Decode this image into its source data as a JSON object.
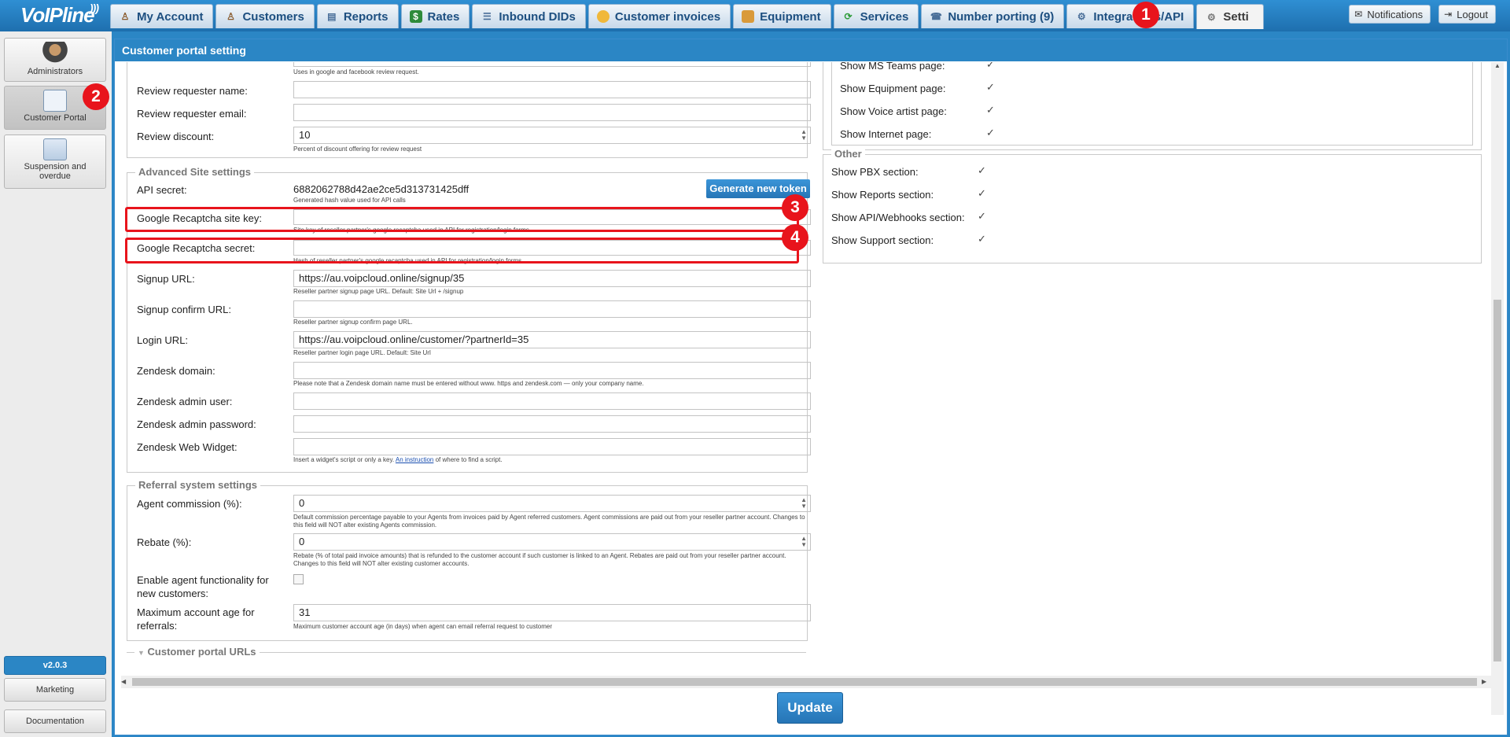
{
  "brand": {
    "logo": "VoIPline"
  },
  "tabs": [
    {
      "label": "My Account",
      "icon": "person-icon",
      "color": "#8a5a2b"
    },
    {
      "label": "Customers",
      "icon": "customers-icon",
      "color": "#8a5a2b"
    },
    {
      "label": "Reports",
      "icon": "reports-icon",
      "color": "#4a6f99"
    },
    {
      "label": "Rates",
      "icon": "rates-icon",
      "color": "#2e8b3a"
    },
    {
      "label": "Inbound DIDs",
      "icon": "list-icon",
      "color": "#4a6f99"
    },
    {
      "label": "Customer invoices",
      "icon": "coins-icon",
      "color": "#e0a21e"
    },
    {
      "label": "Equipment",
      "icon": "box-icon",
      "color": "#c98a2a"
    },
    {
      "label": "Services",
      "icon": "services-icon",
      "color": "#2e9c3a"
    },
    {
      "label": "Number porting (9)",
      "icon": "phone-icon",
      "color": "#4a6f99"
    },
    {
      "label": "Integrations/API",
      "icon": "gear-icon",
      "color": "#4a6f99"
    },
    {
      "label": "Setti",
      "icon": "settings-icon",
      "color": "#7a7a7a"
    }
  ],
  "top_right": {
    "notifications": "Notifications",
    "logout": "Logout"
  },
  "badges": {
    "b1": "1",
    "b2": "2",
    "b3": "3",
    "b4": "4"
  },
  "sidebar": {
    "items": [
      {
        "label": "Administrators"
      },
      {
        "label": "Customer Portal"
      },
      {
        "label": "Suspension and overdue"
      }
    ],
    "version": "v2.0.3",
    "marketing": "Marketing",
    "documentation": "Documentation"
  },
  "panel": {
    "title": "Customer portal setting"
  },
  "review": {
    "top_hint": "Uses in google and facebook review request.",
    "requester_name_label": "Review requester name:",
    "requester_email_label": "Review requester email:",
    "discount_label": "Review discount:",
    "discount_value": "10",
    "discount_hint": "Percent of discount offering for review request"
  },
  "advanced": {
    "legend": "Advanced Site settings",
    "api_secret_label": "API secret:",
    "api_secret_value": "6882062788d42ae2ce5d313731425dff",
    "api_secret_hint": "Generated hash value used for API calls",
    "generate_button": "Generate new token",
    "recaptcha_key_label": "Google Recaptcha site key:",
    "recaptcha_key_hint": "Site key of reseller partner's google recaptcha used in API for registration/login forms",
    "recaptcha_secret_label": "Google Recaptcha secret:",
    "recaptcha_secret_hint": "Hash of reseller partner's google recaptcha used in API for registration/login forms",
    "signup_url_label": "Signup URL:",
    "signup_url_value": "https://au.voipcloud.online/signup/35",
    "signup_url_hint": "Reseller partner signup page URL. Default: Site Url + /signup",
    "signup_confirm_label": "Signup confirm URL:",
    "signup_confirm_hint": "Reseller partner signup confirm page URL.",
    "login_url_label": "Login URL:",
    "login_url_value": "https://au.voipcloud.online/customer/?partnerId=35",
    "login_url_hint": "Reseller partner login page URL. Default: Site Url",
    "zendesk_domain_label": "Zendesk domain:",
    "zendesk_domain_hint": "Please note that a Zendesk domain name must be entered without www. https and zendesk.com — only your company name.",
    "zendesk_user_label": "Zendesk admin user:",
    "zendesk_password_label": "Zendesk admin password:",
    "zendesk_widget_label": "Zendesk Web Widget:",
    "zendesk_widget_hint_a": "Insert a widget's script or only a key.",
    "zendesk_widget_hint_link": "An instruction",
    "zendesk_widget_hint_b": "of where to find a script."
  },
  "referral": {
    "legend": "Referral system settings",
    "agent_commission_label": "Agent commission (%):",
    "agent_commission_value": "0",
    "agent_commission_hint": "Default commission percentage payable to your Agents from invoices paid by Agent referred customers. Agent commissions are paid out from your reseller partner account. Changes to this field will NOT alter existing Agents commission.",
    "rebate_label": "Rebate (%):",
    "rebate_value": "0",
    "rebate_hint": "Rebate (% of total paid invoice amounts) that is refunded to the customer account if such customer is linked to an Agent. Rebates are paid out from your reseller partner account. Changes to this field will NOT alter existing customer accounts.",
    "enable_agent_label": "Enable agent functionality for new customers:",
    "max_age_label": "Maximum account age for referrals:",
    "max_age_value": "31",
    "max_age_hint": "Maximum customer account age (in days) when agent can email referral request to customer"
  },
  "portal_urls": {
    "legend": "Customer portal URLs"
  },
  "pages": {
    "items": [
      {
        "label": "Show MS Teams page:",
        "checked": true
      },
      {
        "label": "Show Equipment page:",
        "checked": true
      },
      {
        "label": "Show Voice artist page:",
        "checked": true
      },
      {
        "label": "Show Internet page:",
        "checked": true
      }
    ]
  },
  "other": {
    "legend": "Other",
    "items": [
      {
        "label": "Show PBX section:",
        "checked": true
      },
      {
        "label": "Show Reports section:",
        "checked": true
      },
      {
        "label": "Show API/Webhooks section:",
        "checked": true
      },
      {
        "label": "Show Support section:",
        "checked": true
      }
    ]
  },
  "update_button": "Update",
  "colors": {
    "accent": "#2b86c5",
    "highlight": "#e8141c"
  }
}
